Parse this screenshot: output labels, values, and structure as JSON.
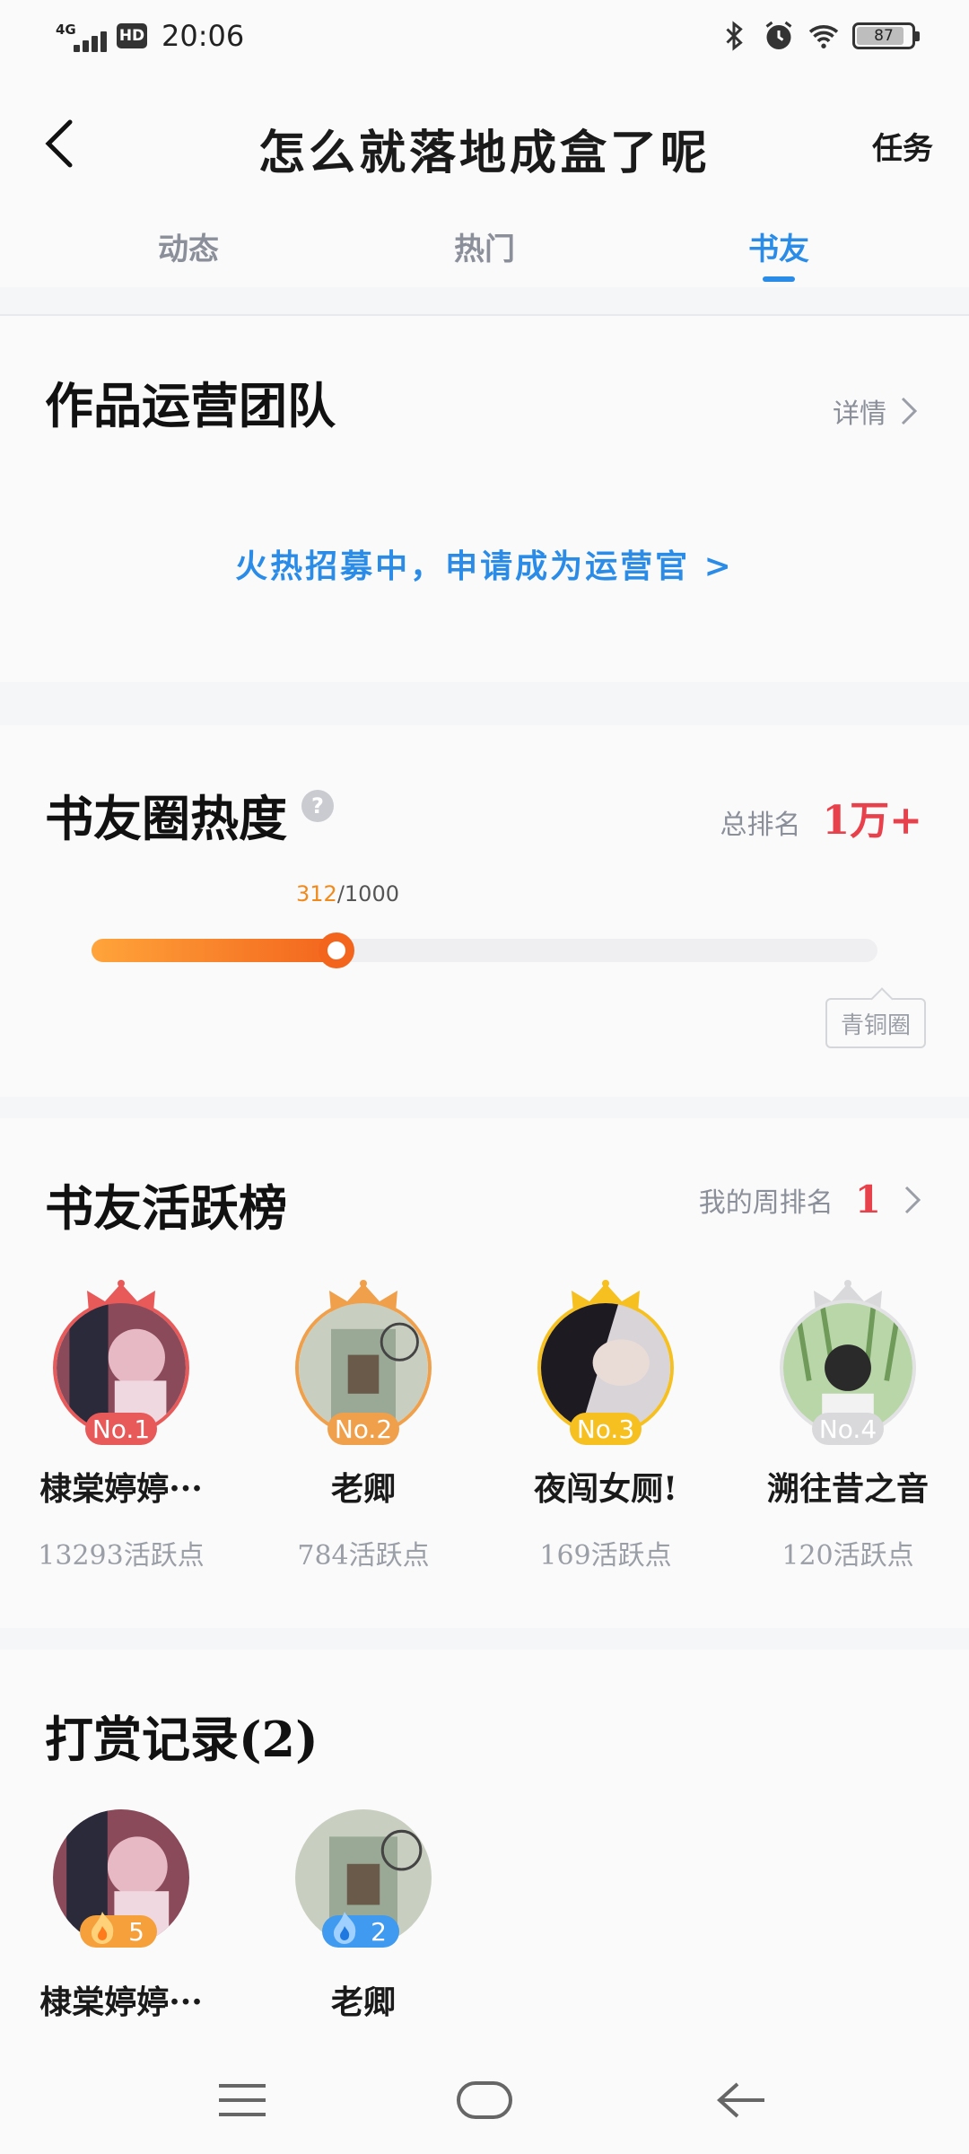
{
  "status_bar": {
    "network": "4G",
    "hd": "HD",
    "time": "20:06",
    "battery": "87",
    "battery_level": 0.87,
    "icons": [
      "bluetooth-icon",
      "alarm-icon",
      "wifi-icon"
    ]
  },
  "header": {
    "title": "怎么就落地成盒了呢",
    "task": "任务",
    "tabs": [
      {
        "label": "动态",
        "active": false
      },
      {
        "label": "热门",
        "active": false
      },
      {
        "label": "书友",
        "active": true
      }
    ]
  },
  "team": {
    "title": "作品运营团队",
    "detail": "详情",
    "recruit": "火热招募中，申请成为运营官 >"
  },
  "heat": {
    "title": "书友圈热度",
    "rank_label": "总排名",
    "rank_value": "1万+",
    "current": "312",
    "max": "/1000",
    "progress_fraction": 0.312,
    "level": "青铜圈"
  },
  "active": {
    "title": "书友活跃榜",
    "my_rank_label": "我的周排名",
    "my_rank_value": "1",
    "members": [
      {
        "rank": "No.1",
        "name": "棣棠婷婷···",
        "points": "13293活跃点",
        "color": "#e85a5a"
      },
      {
        "rank": "No.2",
        "name": "老卿",
        "points": "784活跃点",
        "color": "#f0a04b"
      },
      {
        "rank": "No.3",
        "name": "夜闯女厕!",
        "points": "169活跃点",
        "color": "#f5c020"
      },
      {
        "rank": "No.4",
        "name": "溯往昔之音",
        "points": "120活跃点",
        "color": "#d9d9dc"
      }
    ]
  },
  "tips": {
    "title": "打赏记录(2)",
    "tippers": [
      {
        "name": "棣棠婷婷···",
        "count": "5",
        "color": "#f5a03a"
      },
      {
        "name": "老卿",
        "count": "2",
        "color": "#3f9af0"
      }
    ]
  },
  "nav": {
    "icons": [
      "menu-icon",
      "home-icon",
      "back-icon"
    ]
  }
}
